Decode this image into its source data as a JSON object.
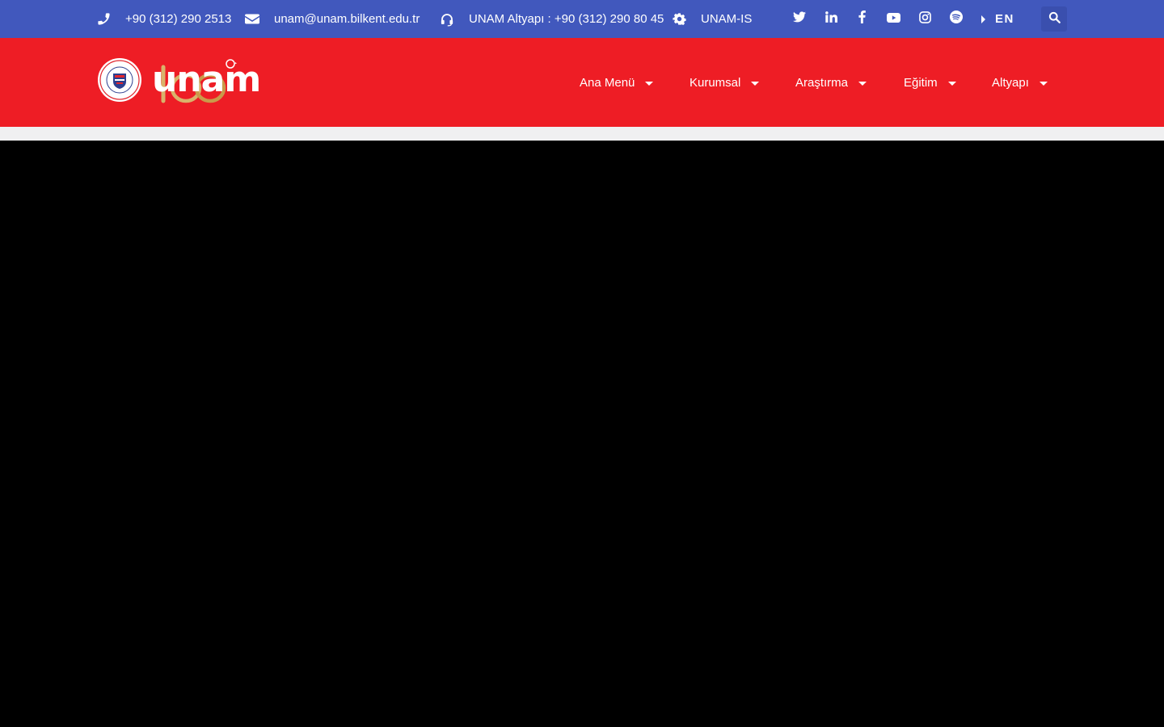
{
  "topbar": {
    "background": "#4158bd",
    "phone": {
      "icon": "phone-icon",
      "text": "+90 (312) 290 2513"
    },
    "email": {
      "icon": "envelope-icon",
      "text": "unam@unam.bilkent.edu.tr"
    },
    "support": {
      "icon": "headset-icon",
      "text": "UNAM Altyapı : +90 (312) 290 80 45"
    },
    "system": {
      "icon": "gear-icon",
      "text": "UNAM-IS"
    },
    "social": [
      "twitter-icon",
      "linkedin-icon",
      "facebook-icon",
      "youtube-icon",
      "instagram-icon",
      "spotify-icon"
    ],
    "language": "EN",
    "search_icon": "search-icon"
  },
  "header": {
    "background": "#ee1d25",
    "logo": {
      "wordmark": "unam"
    },
    "nav": [
      {
        "label": "Ana Menü"
      },
      {
        "label": "Kurumsal"
      },
      {
        "label": "Araştırma"
      },
      {
        "label": "Eğitim"
      },
      {
        "label": "Altyapı"
      }
    ]
  },
  "hero": {
    "background": "#000000"
  }
}
